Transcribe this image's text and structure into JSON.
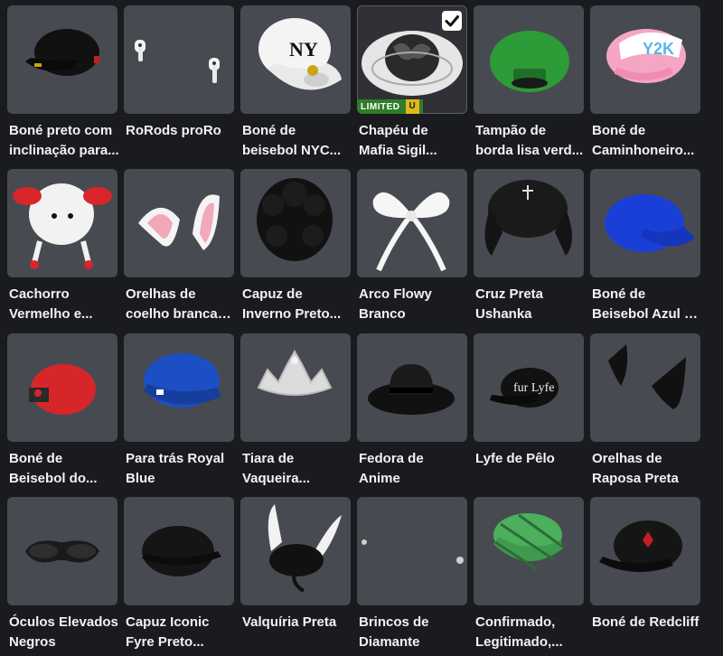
{
  "items": [
    {
      "l1": "Boné preto com",
      "l2": "inclinação para...",
      "icon": "black-cap-icon"
    },
    {
      "l1": "RoRods proRo",
      "l2": "",
      "icon": "earbuds-icon"
    },
    {
      "l1": "Boné de",
      "l2": "beisebol NYC...",
      "icon": "white-ny-cap-icon"
    },
    {
      "l1": "Chapéu de",
      "l2": "Mafia Sigil...",
      "icon": "mafia-hat-icon",
      "equipped": true,
      "badge": "LIMITED",
      "badge_u": "U"
    },
    {
      "l1": "Tampão de",
      "l2": "borda lisa verd...",
      "icon": "green-cap-icon"
    },
    {
      "l1": "Boné de",
      "l2": "Caminhoneiro...",
      "icon": "pink-trucker-cap-icon"
    },
    {
      "l1": "Cachorro",
      "l2": "Vermelho e...",
      "icon": "dog-hat-icon"
    },
    {
      "l1": "Orelhas de",
      "l2": "coelho brancas...",
      "icon": "bunny-ears-icon"
    },
    {
      "l1": "Capuz de",
      "l2": "Inverno Preto...",
      "icon": "black-winter-hood-icon"
    },
    {
      "l1": "Arco Flowy",
      "l2": "Branco",
      "icon": "white-bow-icon"
    },
    {
      "l1": "Cruz Preta",
      "l2": "Ushanka",
      "icon": "ushanka-icon"
    },
    {
      "l1": "Boné de",
      "l2": "Beisebol Azul d...",
      "icon": "blue-cap-icon"
    },
    {
      "l1": "Boné de",
      "l2": "Beisebol do...",
      "icon": "red-cap-icon"
    },
    {
      "l1": "Para trás Royal",
      "l2": "Blue",
      "icon": "royal-blue-cap-icon"
    },
    {
      "l1": "Tiara de",
      "l2": "Vaqueira...",
      "icon": "tiara-icon"
    },
    {
      "l1": "Fedora de",
      "l2": "Anime",
      "icon": "fedora-icon"
    },
    {
      "l1": "Lyfe de Pêlo",
      "l2": "",
      "icon": "fur-lyfe-cap-icon"
    },
    {
      "l1": "Orelhas de",
      "l2": "Raposa Preta",
      "icon": "fox-ears-icon"
    },
    {
      "l1": "Óculos Elevados",
      "l2": "Negros",
      "icon": "goggles-icon"
    },
    {
      "l1": "Capuz Iconic",
      "l2": "Fyre Preto...",
      "icon": "iconic-fyre-cap-icon"
    },
    {
      "l1": "Valquíria Preta",
      "l2": "",
      "icon": "valkyrie-icon"
    },
    {
      "l1": "Brincos de",
      "l2": "Diamante",
      "icon": "earrings-icon"
    },
    {
      "l1": "Confirmado,",
      "l2": "Legitimado,...",
      "icon": "green-plaid-cap-icon"
    },
    {
      "l1": "Boné de Redcliff",
      "l2": "",
      "icon": "redcliff-cap-icon"
    }
  ]
}
